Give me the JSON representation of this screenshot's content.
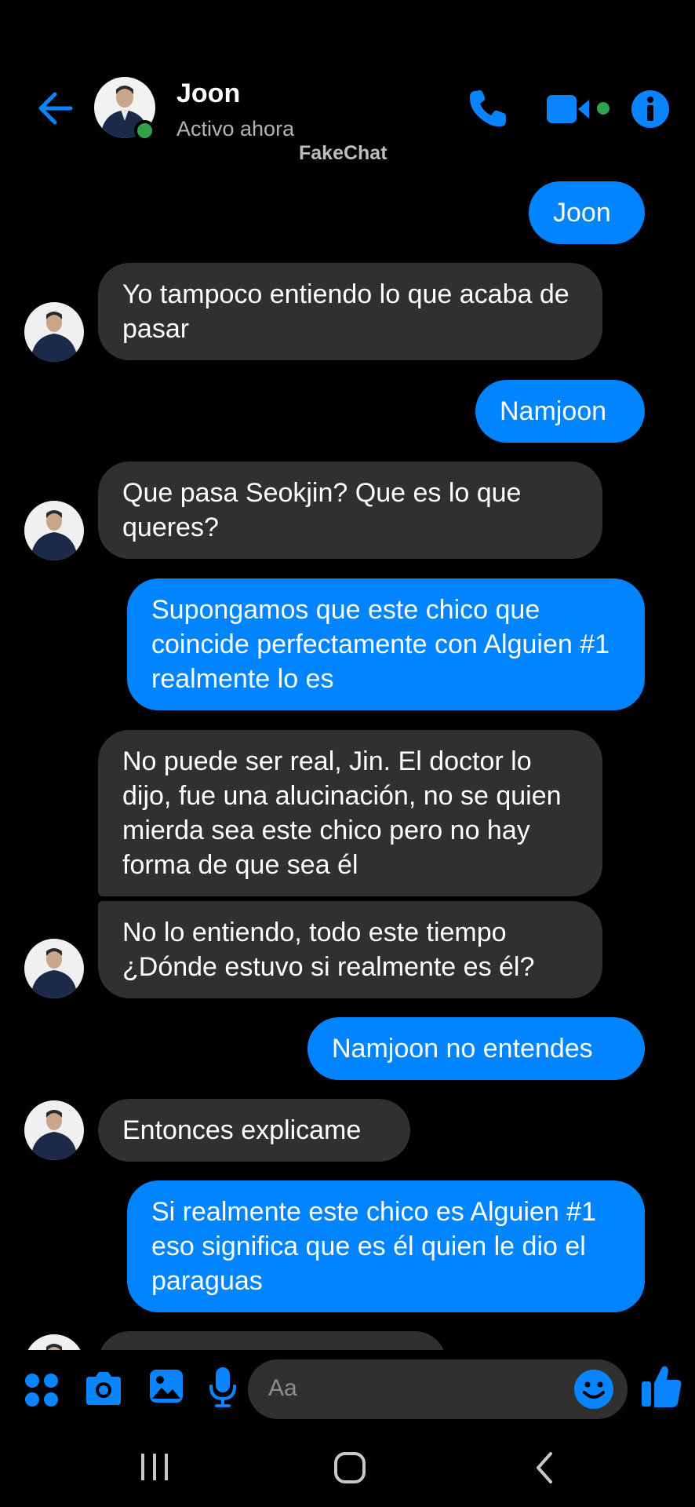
{
  "header": {
    "contact_name": "Joon",
    "status": "Activo ahora",
    "watermark": "FakeChat"
  },
  "messages": [
    {
      "side": "out",
      "text": "Joon"
    },
    {
      "side": "in",
      "text": "Yo tampoco entiendo lo que acaba de pasar"
    },
    {
      "side": "out",
      "text": "Namjoon"
    },
    {
      "side": "in",
      "text": "Que pasa Seokjin? Que es lo que queres?"
    },
    {
      "side": "out",
      "text": "Supongamos que este chico que coincide perfectamente con Alguien #1 realmente lo es"
    },
    {
      "side": "in",
      "text": "No puede ser real, Jin. El doctor lo dijo, fue una alucinación, no se quien mierda sea este chico pero no hay forma de que sea él"
    },
    {
      "side": "in",
      "text": "No lo entiendo, todo este tiempo ¿Dónde estuvo si realmente es él?"
    },
    {
      "side": "out",
      "text": "Namjoon no entendes"
    },
    {
      "side": "in",
      "text": "Entonces explicame"
    },
    {
      "side": "out",
      "text": "Si realmente este chico es Alguien #1 eso significa que es él quien le dio el paraguas"
    }
  ],
  "composer": {
    "placeholder": "Aa"
  },
  "icons": {
    "back": "arrow-left-icon",
    "phone": "phone-icon",
    "video": "video-camera-icon",
    "info": "info-icon",
    "apps": "four-dots-icon",
    "camera": "camera-icon",
    "gallery": "image-icon",
    "mic": "microphone-icon",
    "emoji": "smiley-icon",
    "like": "thumbs-up-icon"
  },
  "colors": {
    "accent": "#0084ff",
    "incoming_bubble": "#303030",
    "background": "#000000",
    "online": "#31a24c"
  }
}
